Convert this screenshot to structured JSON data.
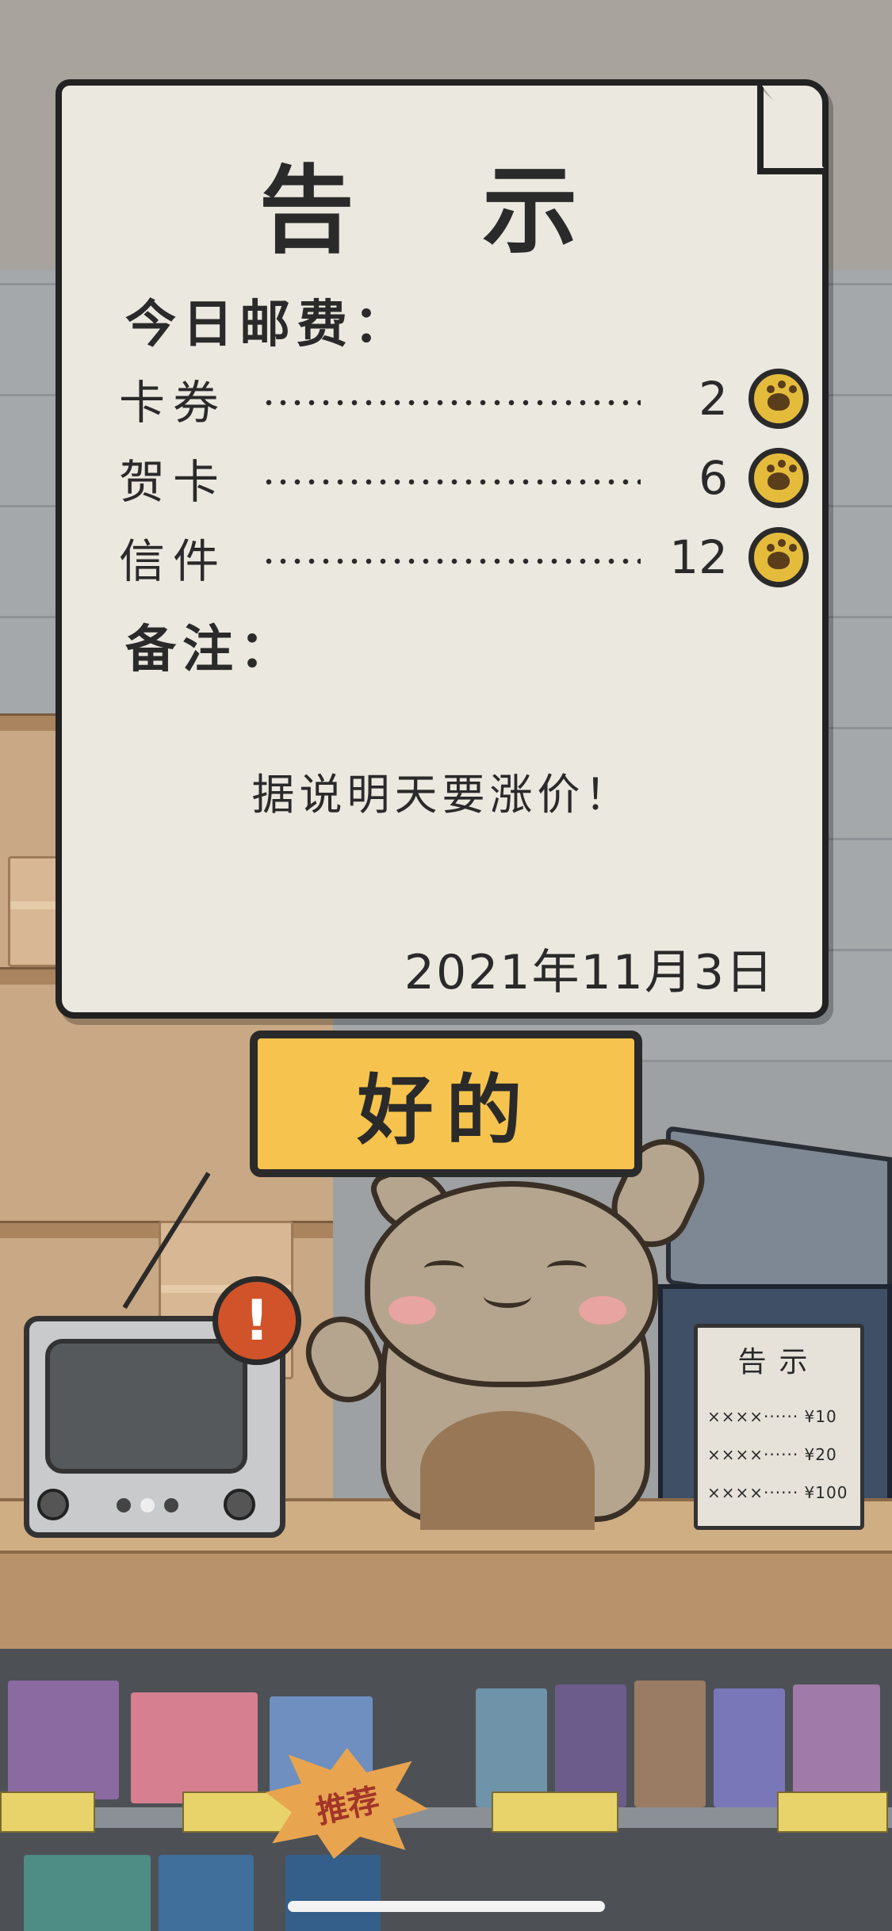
{
  "notice": {
    "title": "告 示",
    "fees_heading": "今日邮费：",
    "fees": [
      {
        "name": "卡券",
        "price": "2",
        "icon": "paw-coin-icon"
      },
      {
        "name": "贺卡",
        "price": "6",
        "icon": "paw-coin-icon"
      },
      {
        "name": "信件",
        "price": "12",
        "icon": "paw-coin-icon"
      }
    ],
    "remarks_heading": "备注：",
    "remarks_text": "据说明天要涨价！",
    "date": "2021年11月3日"
  },
  "confirm_button": {
    "label": "好的"
  },
  "alert_icon": {
    "symbol": "!"
  },
  "small_notice": {
    "title": "告示",
    "rows": [
      "××××······ ¥10",
      "××××······ ¥20",
      "××××······ ¥100"
    ]
  },
  "recommend_tag": {
    "label": "推荐"
  },
  "colors": {
    "paper": "#ebe8df",
    "button": "#f6c44e",
    "coin": "#e5bb3c",
    "alert": "#d1532a",
    "outline": "#2a2a2a"
  }
}
